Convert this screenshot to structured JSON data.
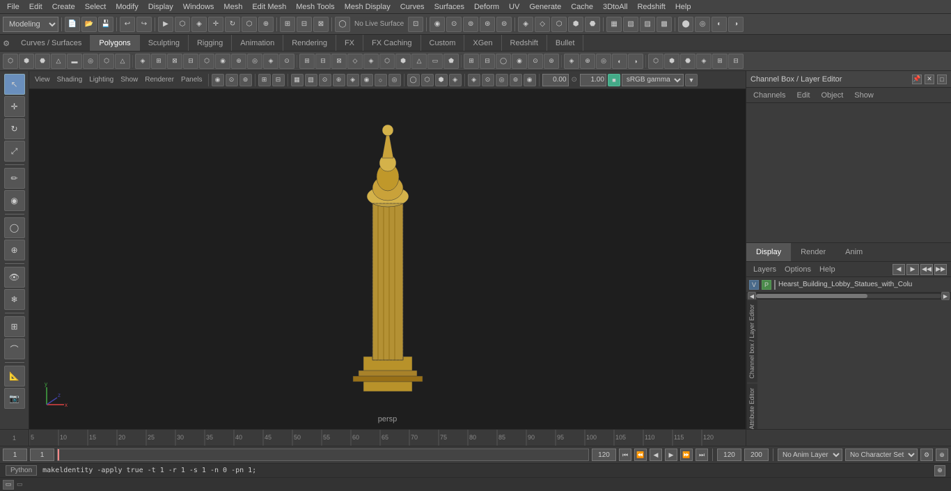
{
  "menubar": {
    "items": [
      "File",
      "Edit",
      "Create",
      "Select",
      "Modify",
      "Display",
      "Windows",
      "Mesh",
      "Edit Mesh",
      "Mesh Tools",
      "Mesh Display",
      "Curves",
      "Surfaces",
      "Deform",
      "UV",
      "Generate",
      "Cache",
      "3DtoAll",
      "Redshift",
      "Help"
    ]
  },
  "toolbar1": {
    "mode": "Modeling",
    "undo_label": "↩",
    "redo_label": "↪"
  },
  "tabs": {
    "items": [
      "Curves / Surfaces",
      "Polygons",
      "Sculpting",
      "Rigging",
      "Animation",
      "Rendering",
      "FX",
      "FX Caching",
      "Custom",
      "XGen",
      "Redshift",
      "Bullet"
    ],
    "active": "Polygons"
  },
  "viewport": {
    "menus": [
      "View",
      "Shading",
      "Lighting",
      "Show",
      "Renderer",
      "Panels"
    ],
    "persp_label": "persp",
    "num1": "0.00",
    "num2": "1.00",
    "color_space": "sRGB gamma"
  },
  "channel_box": {
    "title": "Channel Box / Layer Editor",
    "nav": [
      "Channels",
      "Edit",
      "Object",
      "Show"
    ],
    "display_tabs": [
      "Display",
      "Render",
      "Anim"
    ],
    "active_display_tab": "Display",
    "layer_section": {
      "label": "Layers",
      "menu_items": [
        "Layers",
        "Options",
        "Help"
      ],
      "layer_item": {
        "v": "V",
        "p": "P",
        "name": "Hearst_Building_Lobby_Statues_with_Colu"
      }
    }
  },
  "side_tabs": [
    "Channel box / Layer Editor",
    "Attribute Editor"
  ],
  "timeline": {
    "marks": [
      "5",
      "10",
      "15",
      "20",
      "25",
      "30",
      "35",
      "40",
      "45",
      "50",
      "55",
      "60",
      "65",
      "70",
      "75",
      "80",
      "85",
      "90",
      "95",
      "100",
      "105",
      "110",
      "1"
    ]
  },
  "bottom_controls": {
    "frame_current": "1",
    "frame_start": "1",
    "frame_input": "1",
    "range_end": "120",
    "playback_end": "120",
    "anim_end": "200",
    "no_anim_layer": "No Anim Layer",
    "no_char_set": "No Character Set"
  },
  "python_bar": {
    "label": "Python",
    "command": "makeldentity -apply true -t 1 -r 1 -s 1 -n 0 -pn 1;"
  },
  "window_bar": {
    "item_label": "▭"
  }
}
